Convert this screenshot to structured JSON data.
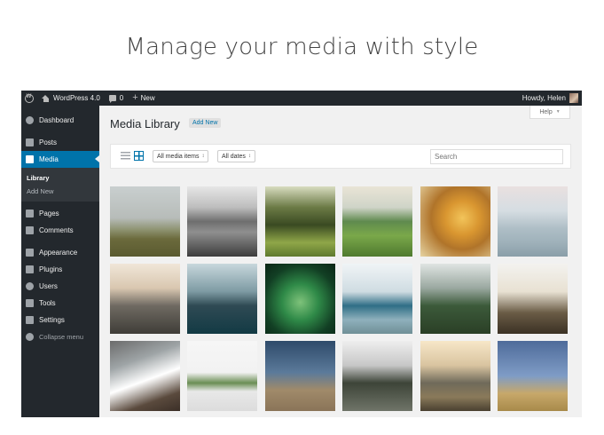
{
  "headline": "Manage your media with style",
  "admin_bar": {
    "site_name": "WordPress 4.0",
    "comments_count": "0",
    "new_label": "New",
    "greeting": "Howdy, Helen"
  },
  "sidebar": {
    "items": [
      {
        "label": "Dashboard",
        "icon": "dashboard-icon"
      },
      {
        "label": "Posts",
        "icon": "pin-icon"
      },
      {
        "label": "Media",
        "icon": "media-icon",
        "active": true
      },
      {
        "label": "Pages",
        "icon": "pages-icon"
      },
      {
        "label": "Comments",
        "icon": "comments-icon"
      },
      {
        "label": "Appearance",
        "icon": "brush-icon"
      },
      {
        "label": "Plugins",
        "icon": "plug-icon"
      },
      {
        "label": "Users",
        "icon": "users-icon"
      },
      {
        "label": "Tools",
        "icon": "wrench-icon"
      },
      {
        "label": "Settings",
        "icon": "settings-icon"
      }
    ],
    "submenu": [
      "Library",
      "Add New"
    ],
    "collapse_label": "Collapse menu"
  },
  "main": {
    "help_label": "Help",
    "page_title": "Media Library",
    "add_new_label": "Add New",
    "filter_type": "All media items",
    "filter_date": "All dates",
    "search_placeholder": "Search"
  },
  "colors": {
    "admin_bar": "#23282d",
    "accent": "#0073aa",
    "background": "#f1f1f1"
  },
  "media_items": [
    {
      "gradient": "linear-gradient(180deg,#c9cfcf 0%,#b7bcb9 45%,#8d9270 62%,#6b6a3c 75%,#5a5a30 100%)"
    },
    {
      "gradient": "linear-gradient(180deg,#e6e6e6 0%,#bdbdbd 30%,#6e6e6e 50%,#8f8f8f 65%,#3c3c3c 100%)"
    },
    {
      "gradient": "linear-gradient(180deg,#d8dcc0 0%,#6b7a45 30%,#3a4a22 55%,#8fa648 80%,#5e7a2e 100%)"
    },
    {
      "gradient": "linear-gradient(180deg,#e9e4d6 0%,#cfd4c8 30%,#5f8a4e 50%,#7aa84a 70%,#4f7a2f 100%)"
    },
    {
      "gradient": "radial-gradient(circle at 60% 45%,#f2c45a 0%,#d99630 30%,#b0742a 55%,#e6d3a2 100%)"
    },
    {
      "gradient": "linear-gradient(180deg,#e9e0e0 0%,#d5dde2 35%,#aebec6 60%,#9fb1ba 80%,#8a9ea8 100%)"
    },
    {
      "gradient": "linear-gradient(180deg,#f0e6d8 0%,#d9c7b0 35%,#6f6a62 60%,#3f3d38 100%)"
    },
    {
      "gradient": "linear-gradient(180deg,#c7d7dc 0%,#7d9aa3 40%,#2f4a54 60%,#123a44 100%)"
    },
    {
      "gradient": "radial-gradient(circle at 50% 55%,#7ec27a 0%,#2f8a48 35%,#123f24 70%,#0a2616 100%)"
    },
    {
      "gradient": "linear-gradient(180deg,#f0f4f6 0%,#cfdce2 40%,#2f6e86 60%,#8fb0bc 80%,#6f8f96 100%)"
    },
    {
      "gradient": "linear-gradient(180deg,#dfe4e2 0%,#9aa8a0 35%,#3c5a3a 60%,#2a3f26 100%)"
    },
    {
      "gradient": "linear-gradient(180deg,#f3f2ef 0%,#e8e1d2 40%,#6a5c46 70%,#3b3124 100%)"
    },
    {
      "gradient": "linear-gradient(160deg,#6b6b6b 0%,#9ea4a6 30%,#ffffff 55%,#5a4a3d 80%,#3b2f27 100%)"
    },
    {
      "gradient": "linear-gradient(180deg,#f6f6f6 0%,#f2f2f2 45%,#6a8e54 60%,#e8e8e8 72%,#dcdcdc 100%)"
    },
    {
      "gradient": "linear-gradient(180deg,#2e4a6a 0%,#5b7a9a 45%,#a08a6a 70%,#8a7458 100%)"
    },
    {
      "gradient": "linear-gradient(180deg,#eeeeee 0%,#c7c7c7 35%,#3d4438 60%,#6f7468 100%)"
    },
    {
      "gradient": "linear-gradient(180deg,#f7e7c8 0%,#d9c4a0 35%,#6f6a5a 60%,#8a7a5a 80%,#4a4030 100%)"
    },
    {
      "gradient": "linear-gradient(180deg,#4e6b9a 0%,#7f9cc6 50%,#c7a86a 75%,#a88a4a 100%)"
    }
  ]
}
